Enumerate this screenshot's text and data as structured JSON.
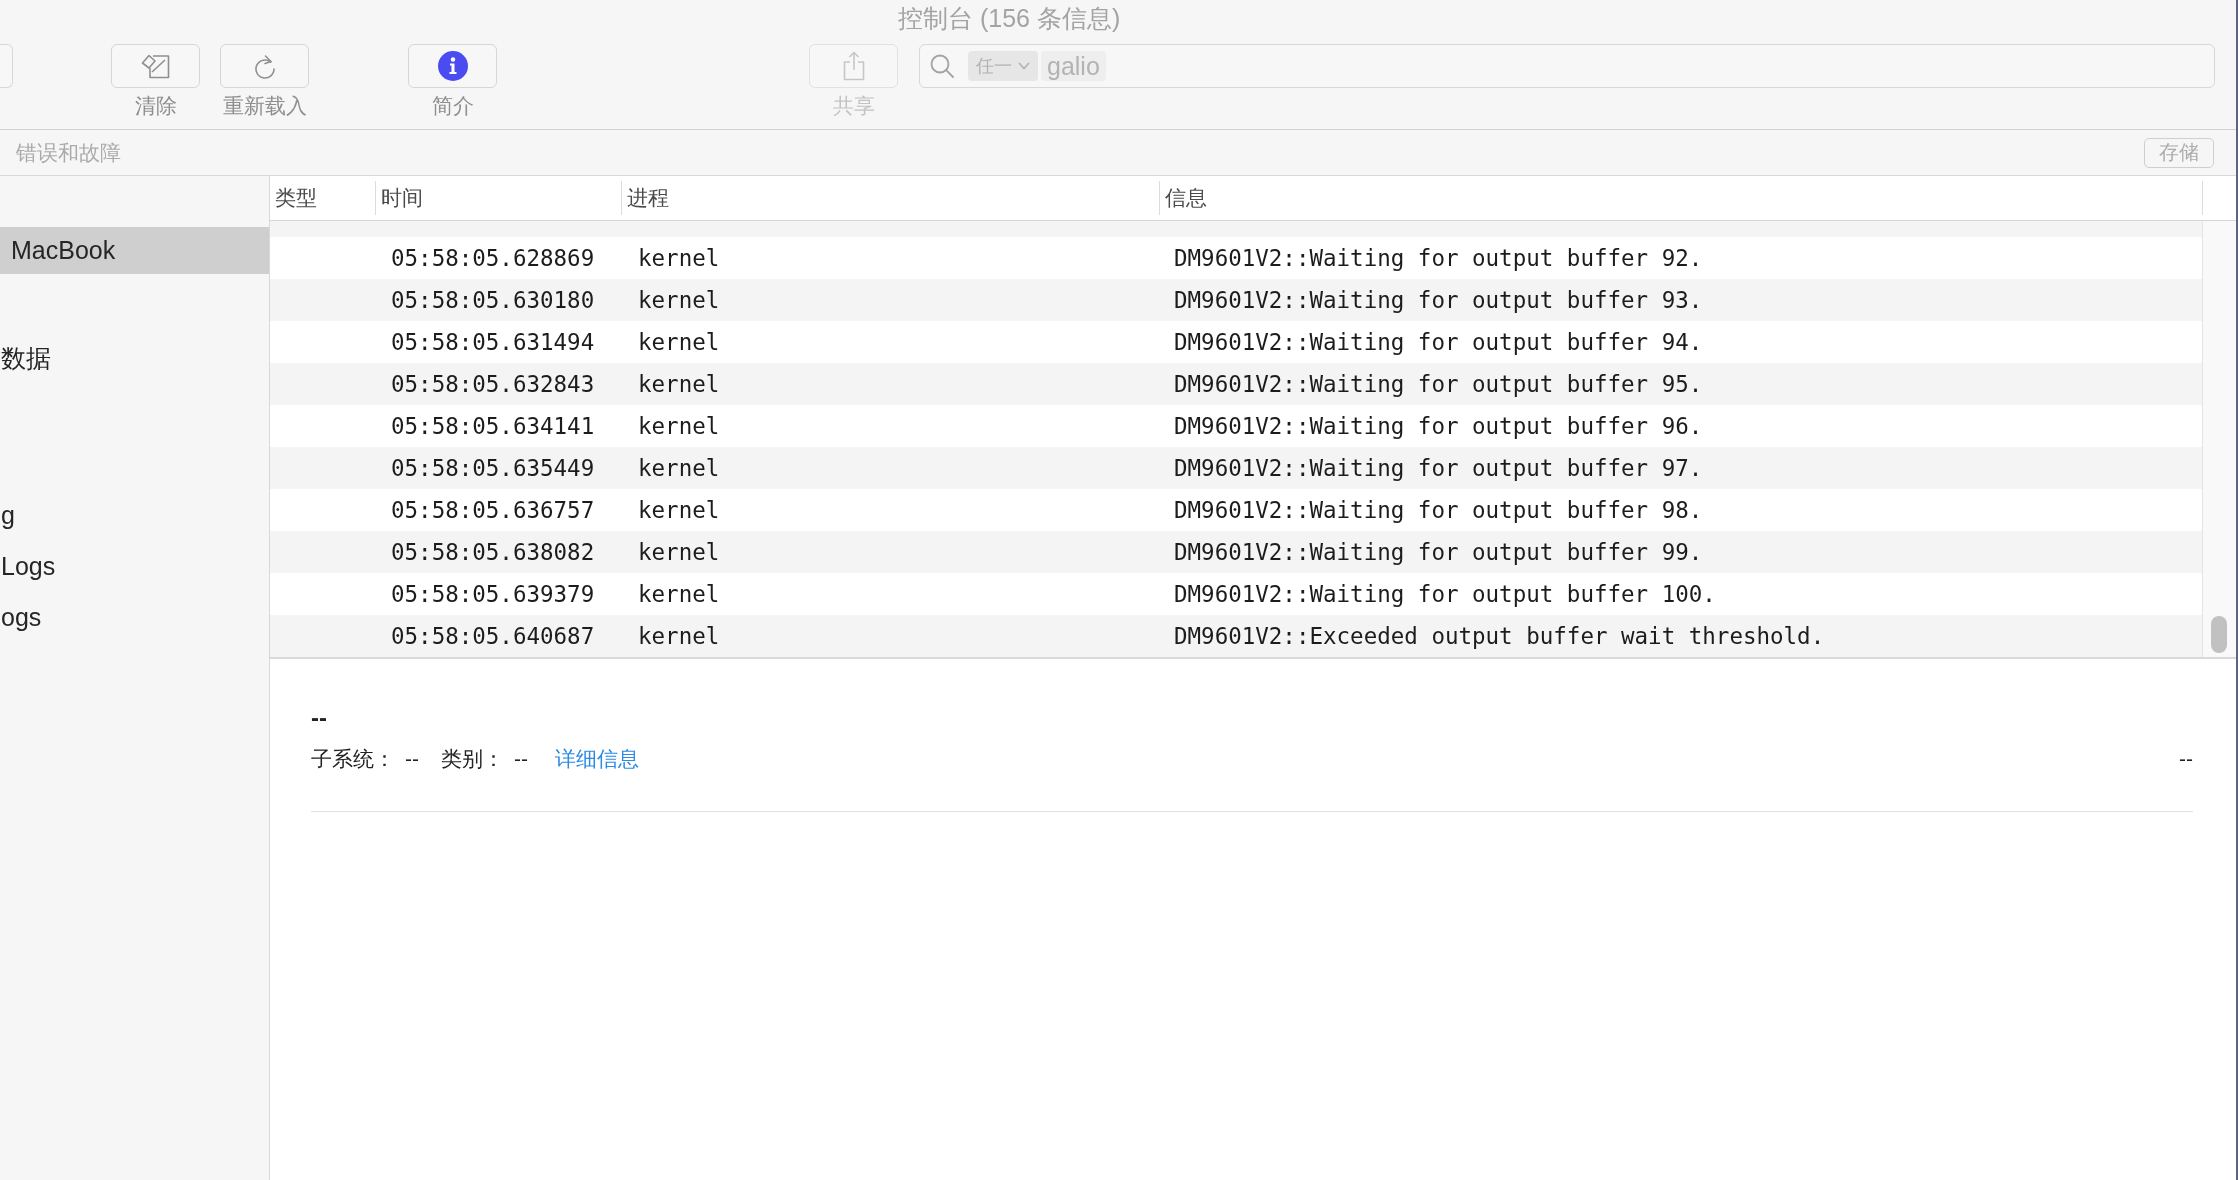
{
  "window": {
    "title": "控制台 (156 条信息)"
  },
  "toolbar": {
    "groups": [
      {
        "buttons": [
          {
            "kind": "clear",
            "label": "清除",
            "disabled": false
          },
          {
            "kind": "reload",
            "label": "重新载入",
            "disabled": false
          }
        ]
      },
      {
        "buttons": [
          {
            "kind": "info",
            "label": "简介",
            "disabled": false
          }
        ]
      },
      {
        "buttons": [
          {
            "kind": "share",
            "label": "共享",
            "disabled": true
          }
        ]
      }
    ],
    "search": {
      "tokens": [
        {
          "kind": "menu",
          "label": "任一"
        },
        {
          "kind": "text",
          "label": "galio"
        }
      ]
    }
  },
  "filter_bar": {
    "label": "错误和故障",
    "save_button": "存储"
  },
  "sidebar": {
    "sections": [
      {
        "items": [
          {
            "label": "MacBook",
            "selected": true
          }
        ]
      },
      {
        "items": [
          {
            "label": "数据",
            "selected": false
          }
        ]
      },
      {
        "items": [
          {
            "label": "g",
            "selected": false
          },
          {
            "label": "Logs",
            "selected": false
          },
          {
            "label": "ogs",
            "selected": false
          }
        ]
      }
    ]
  },
  "table": {
    "columns": [
      "类型",
      "时间",
      "进程",
      "信息"
    ],
    "rows": [
      {
        "time": "05:58:05.628869",
        "process": "kernel",
        "message": "DM9601V2::Waiting for output buffer 92."
      },
      {
        "time": "05:58:05.630180",
        "process": "kernel",
        "message": "DM9601V2::Waiting for output buffer 93."
      },
      {
        "time": "05:58:05.631494",
        "process": "kernel",
        "message": "DM9601V2::Waiting for output buffer 94."
      },
      {
        "time": "05:58:05.632843",
        "process": "kernel",
        "message": "DM9601V2::Waiting for output buffer 95."
      },
      {
        "time": "05:58:05.634141",
        "process": "kernel",
        "message": "DM9601V2::Waiting for output buffer 96."
      },
      {
        "time": "05:58:05.635449",
        "process": "kernel",
        "message": "DM9601V2::Waiting for output buffer 97."
      },
      {
        "time": "05:58:05.636757",
        "process": "kernel",
        "message": "DM9601V2::Waiting for output buffer 98."
      },
      {
        "time": "05:58:05.638082",
        "process": "kernel",
        "message": "DM9601V2::Waiting for output buffer 99."
      },
      {
        "time": "05:58:05.639379",
        "process": "kernel",
        "message": "DM9601V2::Waiting for output buffer 100."
      },
      {
        "time": "05:58:05.640687",
        "process": "kernel",
        "message": "DM9601V2::Exceeded output buffer wait threshold."
      }
    ]
  },
  "detail": {
    "title": "--",
    "fields": [
      {
        "label": "子系统：",
        "value": "--"
      },
      {
        "label": "类别：",
        "value": "--"
      }
    ],
    "link": "详细信息",
    "right_value": "--"
  }
}
